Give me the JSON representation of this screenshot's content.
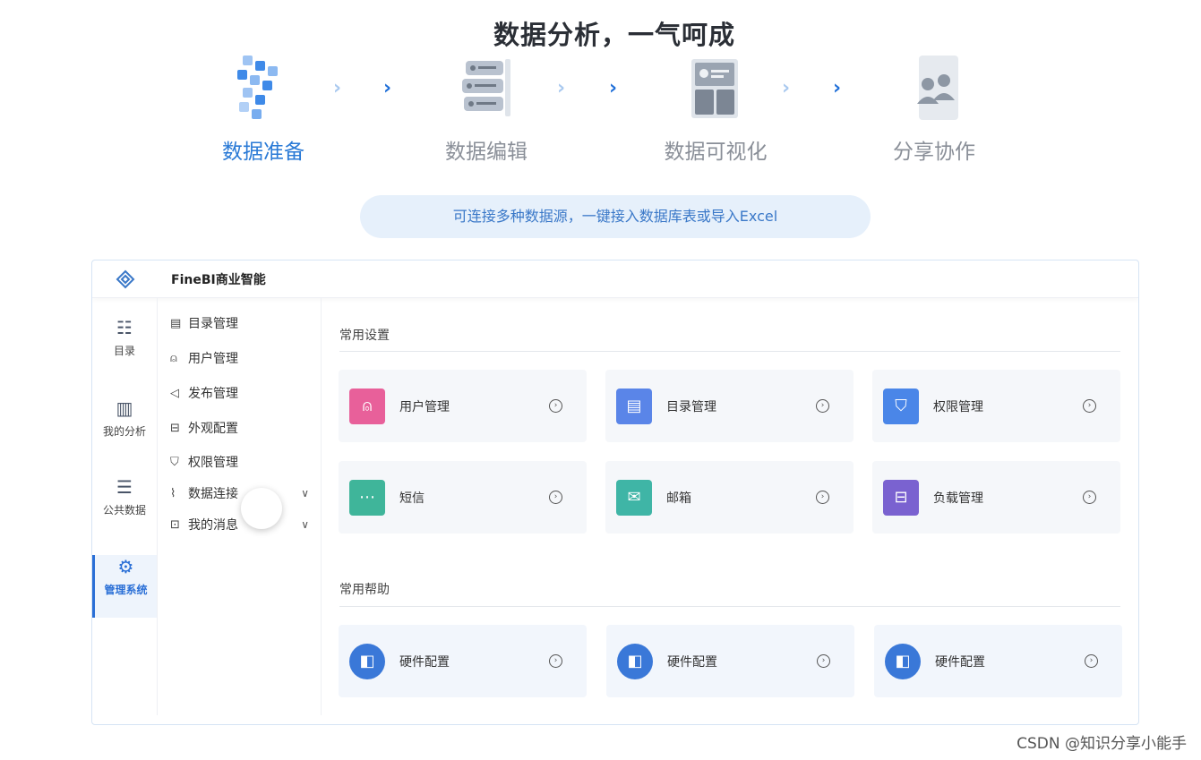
{
  "hero": {
    "title": "数据分析，一气呵成"
  },
  "steps": [
    {
      "label": "数据准备",
      "icon": "data-blocks-icon",
      "active": true
    },
    {
      "label": "数据编辑",
      "icon": "data-stack-icon",
      "active": false
    },
    {
      "label": "数据可视化",
      "icon": "dashboard-icon",
      "active": false
    },
    {
      "label": "分享协作",
      "icon": "users-share-icon",
      "active": false
    }
  ],
  "banner": {
    "text": "可连接多种数据源，一键接入数据库表或导入Excel"
  },
  "app": {
    "title": "FineBI商业智能",
    "rail": [
      {
        "label": "目录",
        "icon": "catalog-icon"
      },
      {
        "label": "我的分析",
        "icon": "analysis-icon"
      },
      {
        "label": "公共数据",
        "icon": "database-icon"
      },
      {
        "label": "管理系统",
        "icon": "gear-icon",
        "active": true
      }
    ],
    "menu": [
      {
        "label": "目录管理",
        "icon": "list-icon"
      },
      {
        "label": "用户管理",
        "icon": "user-icon"
      },
      {
        "label": "发布管理",
        "icon": "send-icon"
      },
      {
        "label": "外观配置",
        "icon": "paint-roller-icon"
      },
      {
        "label": "权限管理",
        "icon": "shield-icon"
      },
      {
        "label": "数据连接",
        "icon": "paperclip-icon",
        "expandable": true
      },
      {
        "label": "我的消息",
        "icon": "message-icon",
        "expandable": true
      }
    ],
    "settings": {
      "title": "常用设置",
      "cards": [
        {
          "label": "用户管理",
          "icon": "user-card-icon",
          "color": "#e8609a"
        },
        {
          "label": "目录管理",
          "icon": "list-card-icon",
          "color": "#5a85e8"
        },
        {
          "label": "权限管理",
          "icon": "shield-card-icon",
          "color": "#4a86e8"
        },
        {
          "label": "短信",
          "icon": "sms-icon",
          "color": "#3fb59a"
        },
        {
          "label": "邮箱",
          "icon": "mail-icon",
          "color": "#3fb5a6"
        },
        {
          "label": "负载管理",
          "icon": "server-icon",
          "color": "#7a62d0"
        }
      ]
    },
    "help": {
      "title": "常用帮助",
      "cards": [
        {
          "label": "硬件配置",
          "icon": "hardware-icon",
          "color": "#3a78d8"
        },
        {
          "label": "硬件配置",
          "icon": "hardware-icon",
          "color": "#3a78d8"
        },
        {
          "label": "硬件配置",
          "icon": "hardware-icon",
          "color": "#3a78d8"
        }
      ]
    }
  },
  "watermark": {
    "text": "CSDN @知识分享小能手"
  }
}
